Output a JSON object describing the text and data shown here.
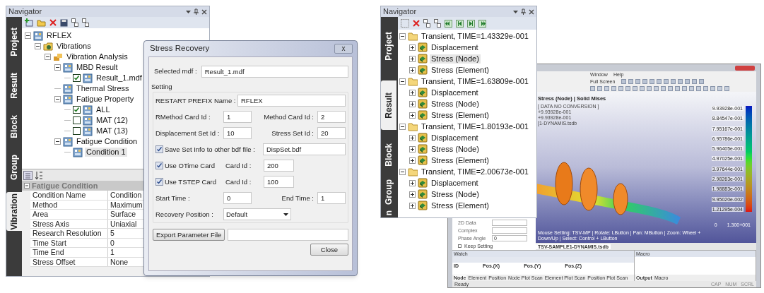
{
  "left_navigator": {
    "title": "Navigator",
    "side_tabs": [
      {
        "label": "Project",
        "selected": false
      },
      {
        "label": "Result",
        "selected": false
      },
      {
        "label": "Block",
        "selected": false
      },
      {
        "label": "Group",
        "selected": false
      },
      {
        "label": "Vibration",
        "selected": true
      }
    ],
    "tree": [
      {
        "label": "RFLEX",
        "kind": "model",
        "expanded": true,
        "selected": false,
        "children": [
          {
            "label": "Vibrations",
            "kind": "vibration",
            "expanded": true,
            "selected": false,
            "children": [
              {
                "label": "Vibration Analysis",
                "kind": "analysis",
                "expanded": true,
                "selected": false,
                "children": [
                  {
                    "label": "MBD Result",
                    "kind": "model",
                    "expanded": true,
                    "selected": false,
                    "children": [
                      {
                        "label": "Result_1.mdf",
                        "kind": "model",
                        "checked": true,
                        "selected": false
                      }
                    ]
                  },
                  {
                    "label": "Thermal Stress",
                    "kind": "model",
                    "selected": false
                  },
                  {
                    "label": "Fatigue Property",
                    "kind": "model",
                    "expanded": true,
                    "selected": false,
                    "children": [
                      {
                        "label": "ALL",
                        "kind": "model",
                        "checked": true,
                        "selected": false
                      },
                      {
                        "label": "MAT (12)",
                        "kind": "model",
                        "checked": false,
                        "selected": false
                      },
                      {
                        "label": "MAT (13)",
                        "kind": "model",
                        "checked": false,
                        "selected": false
                      }
                    ]
                  },
                  {
                    "label": "Fatigue Condition",
                    "kind": "model",
                    "expanded": true,
                    "selected": false,
                    "children": [
                      {
                        "label": "Condition 1",
                        "kind": "model",
                        "selected": true
                      }
                    ]
                  }
                ]
              }
            ]
          }
        ]
      }
    ],
    "property_grid": {
      "category": "Fatigue Condition",
      "expanded": true,
      "rows": [
        {
          "name": "Condition Name",
          "value": "Condition"
        },
        {
          "name": "Method",
          "value": "Maximum"
        },
        {
          "name": "Area",
          "value": "Surface"
        },
        {
          "name": "Stress Axis",
          "value": "Uniaxial"
        },
        {
          "name": "Research Resolution",
          "value": "5"
        },
        {
          "name": "Time Start",
          "value": "0"
        },
        {
          "name": "Time End",
          "value": "1"
        },
        {
          "name": "Stress Offset",
          "value": "None"
        }
      ]
    }
  },
  "dialog": {
    "title": "Stress Recovery",
    "close_glyph": "x",
    "selected_mdf": {
      "label": "Selected mdf :",
      "value": "Result_1.mdf"
    },
    "setting": {
      "title": "Setting",
      "restart_prefix": {
        "label": "RESTART PREFIX Name :",
        "value": "RFLEX"
      },
      "rmethod_card_id": {
        "label": "RMethod Card Id :",
        "value": "1"
      },
      "method_card_id": {
        "label": "Method Card Id :",
        "value": "2"
      },
      "displacement_set_id": {
        "label": "Displacement Set Id :",
        "value": "10"
      },
      "stress_set_id": {
        "label": "Stress Set Id :",
        "value": "20"
      },
      "save_set_info": {
        "label": "Save Set Info to other bdf file :",
        "checked": true,
        "value": "DispSet.bdf"
      },
      "use_otime_card": {
        "label": "Use OTime Card",
        "checked": true,
        "card_id_label": "Card Id :",
        "value": "200"
      },
      "use_tstep_card": {
        "label": "Use TSTEP Card",
        "checked": true,
        "card_id_label": "Card Id :",
        "value": "100"
      },
      "start_time": {
        "label": "Start Time :",
        "value": "0"
      },
      "end_time": {
        "label": "End Time :",
        "value": "1"
      },
      "recovery_position": {
        "label": "Recovery Position :",
        "value": "Default"
      }
    },
    "export_button": "Export Parameter File",
    "close_button": "Close"
  },
  "right_navigator": {
    "title": "Navigator",
    "side_tabs": [
      {
        "label": "Project",
        "selected": false
      },
      {
        "label": "Result",
        "selected": true
      },
      {
        "label": "Block",
        "selected": false
      },
      {
        "label": "Group",
        "selected": false
      },
      {
        "label": "n",
        "selected": false
      }
    ],
    "tree": [
      {
        "label": "Transient, TIME=1.43329e-001",
        "kind": "folder",
        "expanded": true,
        "selected": false,
        "children": [
          {
            "label": "Displacement",
            "kind": "result",
            "expanded": false,
            "selected": false
          },
          {
            "label": "Stress (Node)",
            "kind": "result",
            "expanded": false,
            "selected": true
          },
          {
            "label": "Stress (Element)",
            "kind": "result",
            "expanded": false,
            "selected": false
          }
        ]
      },
      {
        "label": "Transient, TIME=1.63809e-001",
        "kind": "folder",
        "expanded": true,
        "selected": false,
        "children": [
          {
            "label": "Displacement",
            "kind": "result",
            "expanded": false,
            "selected": false
          },
          {
            "label": "Stress (Node)",
            "kind": "result",
            "expanded": false,
            "selected": false
          },
          {
            "label": "Stress (Element)",
            "kind": "result",
            "expanded": false,
            "selected": false
          }
        ]
      },
      {
        "label": "Transient, TIME=1.80193e-001",
        "kind": "folder",
        "expanded": true,
        "selected": false,
        "children": [
          {
            "label": "Displacement",
            "kind": "result",
            "expanded": false,
            "selected": false
          },
          {
            "label": "Stress (Node)",
            "kind": "result",
            "expanded": false,
            "selected": false
          },
          {
            "label": "Stress (Element)",
            "kind": "result",
            "expanded": false,
            "selected": false
          }
        ]
      },
      {
        "label": "Transient, TIME=2.00673e-001",
        "kind": "folder",
        "expanded": true,
        "selected": false,
        "children": [
          {
            "label": "Displacement",
            "kind": "result",
            "expanded": false,
            "selected": false
          },
          {
            "label": "Stress (Node)",
            "kind": "result",
            "expanded": false,
            "selected": false
          },
          {
            "label": "Stress (Element)",
            "kind": "result",
            "expanded": false,
            "selected": false
          }
        ]
      }
    ]
  },
  "app_window": {
    "menu": [
      "Window",
      "Help"
    ],
    "full_screen": "Full Screen",
    "left_panel": [
      {
        "label": "2D Data",
        "kind": "dropdown"
      },
      {
        "label": "Complex",
        "kind": "dropdown"
      },
      {
        "label": "Phase Angle",
        "kind": "input",
        "value": "0"
      },
      {
        "label": "Keep Setting",
        "kind": "checkbox",
        "checked": false
      }
    ],
    "viewport": {
      "title": "Stress (Node) | Solid Mises",
      "info": [
        "[ DATA NO CONVERSION ]",
        "+9.93928e-001",
        "+9.93928e-001",
        "[1-DYNAMIS.tsdb"
      ],
      "legend": [
        "9.93928e-001",
        "8.84547e-001",
        "7.95167e-001",
        "6.95786e-001",
        "5.96405e-001",
        "4.97025e-001",
        "3.97644e-001",
        "2.98263e-001",
        "1.98883e-001",
        "9.95020e-002",
        "1.21295e-004"
      ],
      "scale": [
        "0",
        "1.300+001"
      ],
      "mouse_setting": "Mouse Setting: TSV-MP | Rotate: LButton | Pan: MButton | Zoom: Wheel + Down/Up | Select: Control + LButton"
    },
    "document_tab": "TSV-SAMPLE1-DYNAMIS.tsdb",
    "watch": {
      "title": "Watch",
      "columns": [
        "ID",
        "Pos.(X)",
        "Pos.(Y)",
        "Pos.(Z)"
      ],
      "tabs": [
        {
          "label": "Node",
          "selected": true
        },
        {
          "label": "Element",
          "selected": false
        },
        {
          "label": "Position",
          "selected": false
        },
        {
          "label": "Node Plot Scan",
          "selected": false
        },
        {
          "label": "Element Plot Scan",
          "selected": false
        },
        {
          "label": "Position Plot Scan",
          "selected": false
        }
      ]
    },
    "macro": {
      "title": "Macro",
      "tabs": [
        {
          "label": "Output",
          "selected": true
        },
        {
          "label": "Macro",
          "selected": false
        }
      ]
    },
    "status": "Ready",
    "indicators": [
      "CAP",
      "NUM",
      "SCRL"
    ]
  }
}
